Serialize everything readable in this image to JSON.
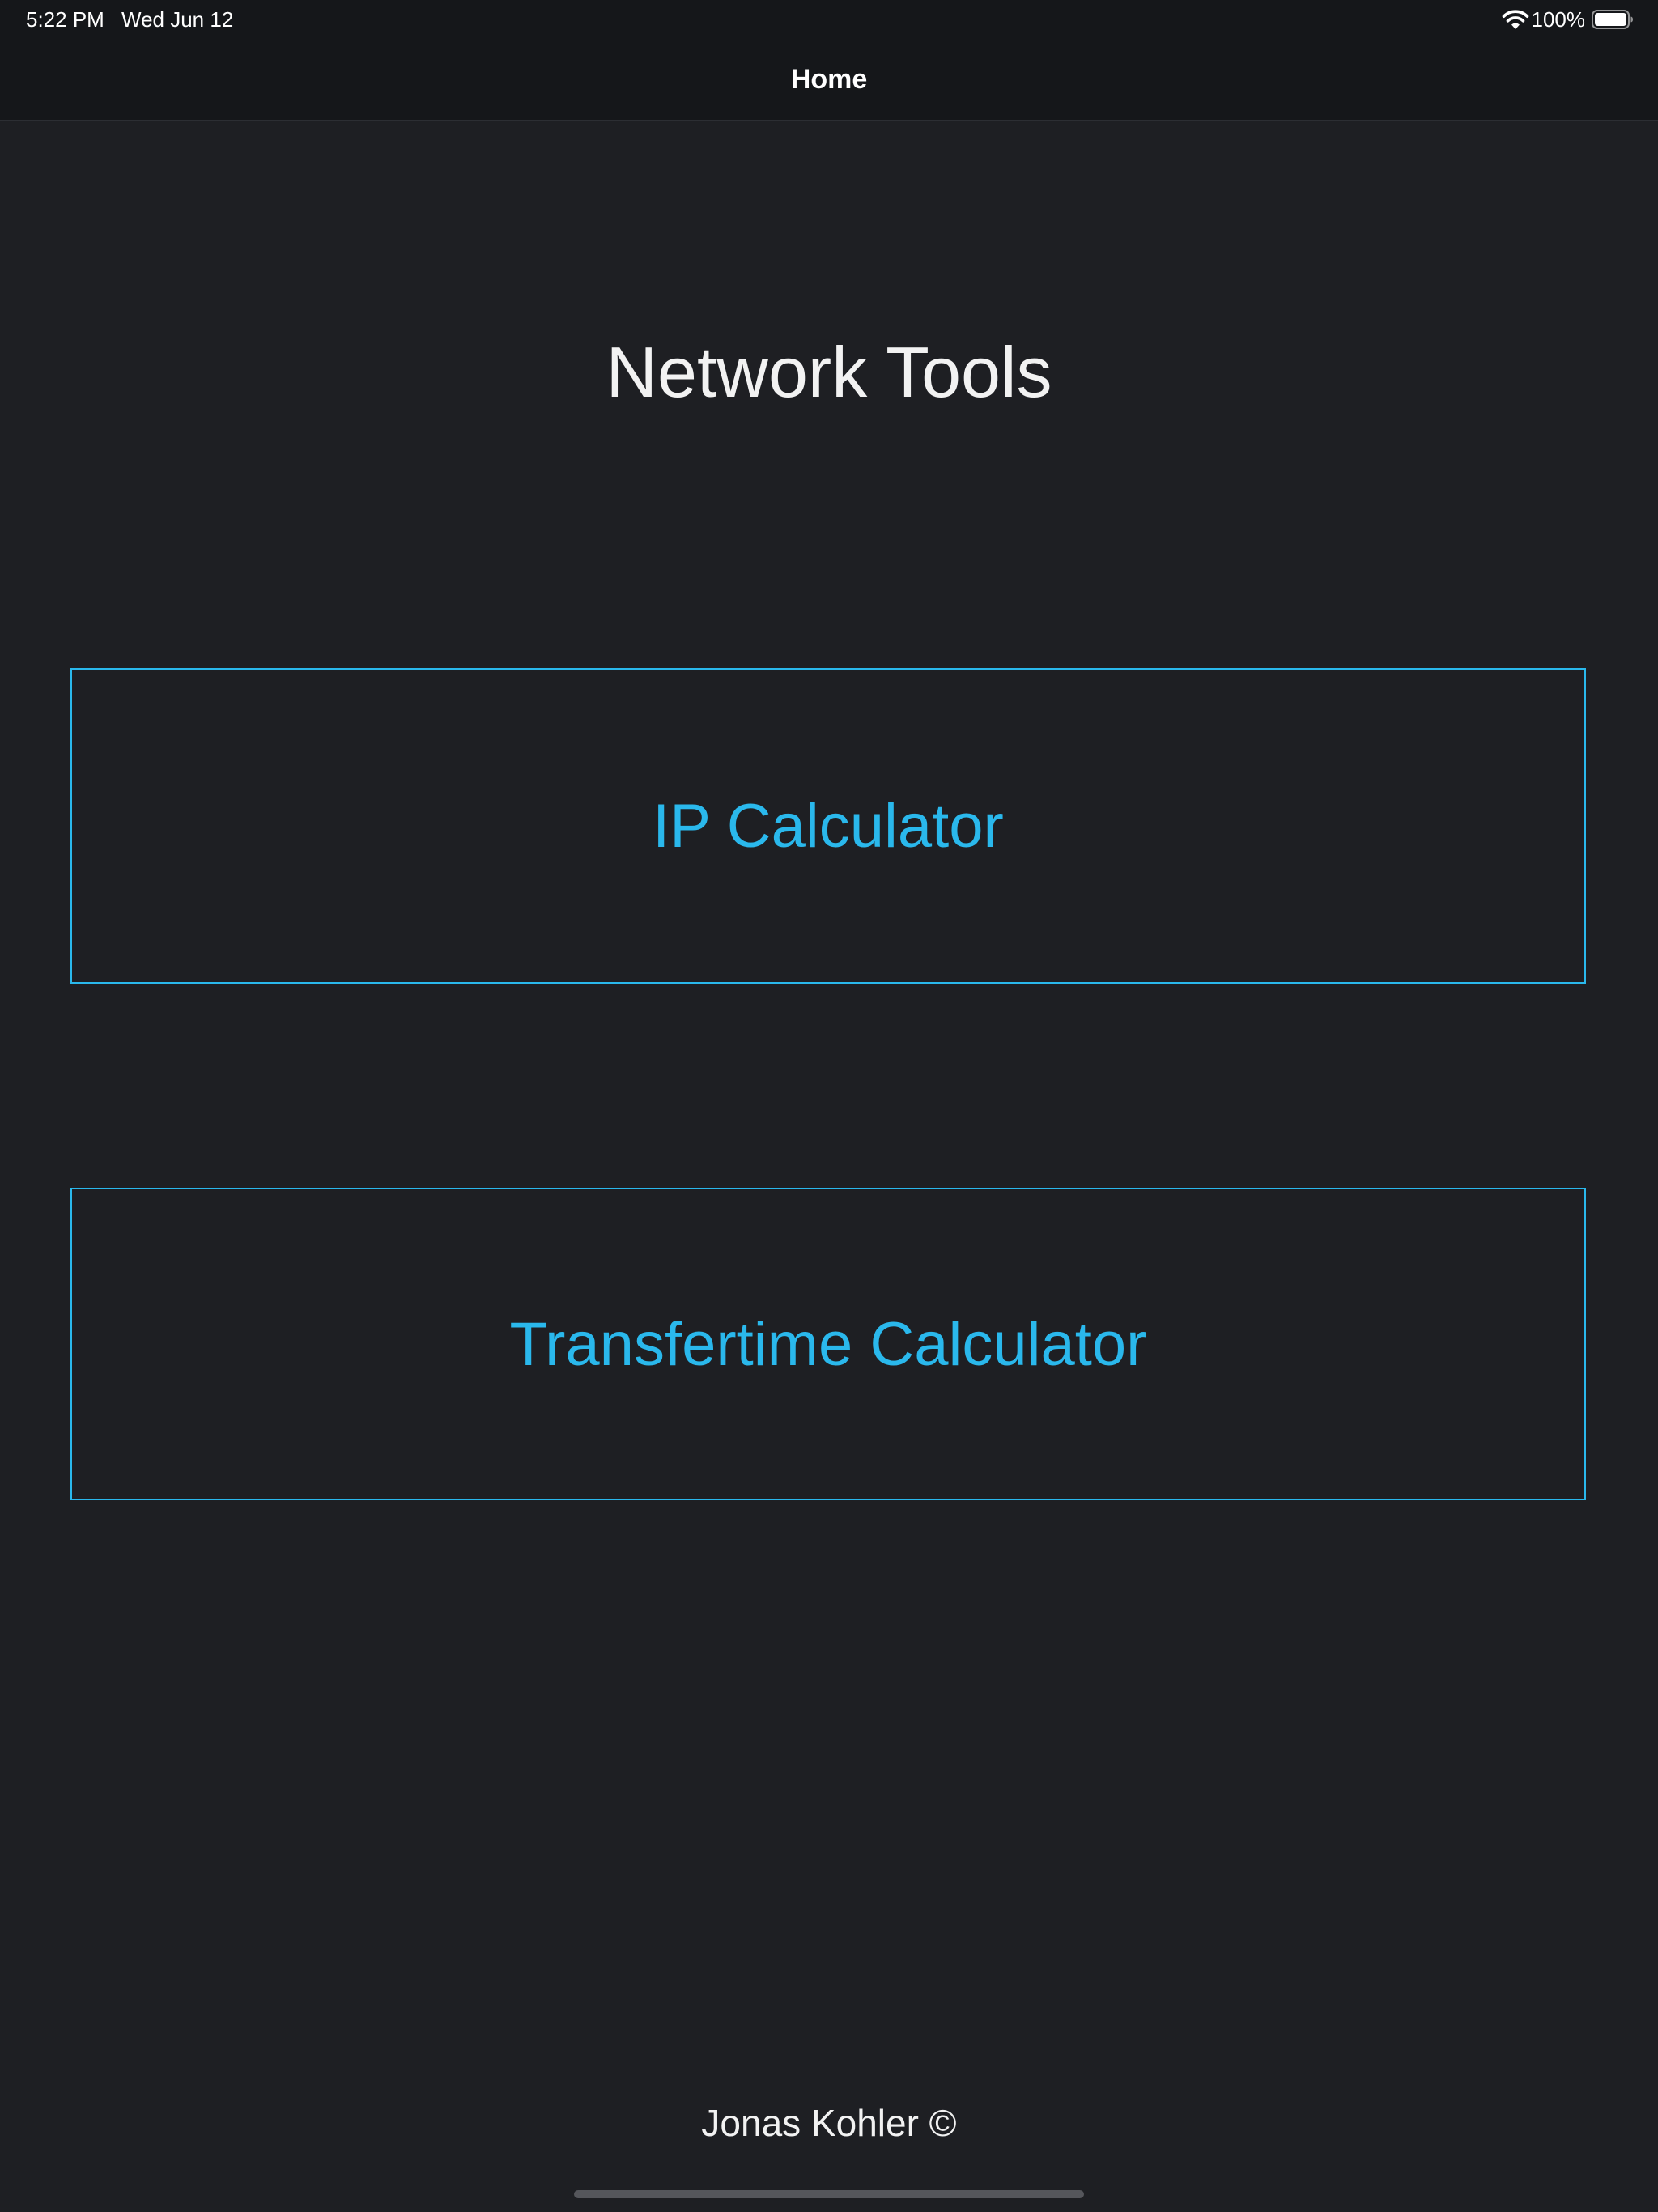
{
  "status_bar": {
    "time": "5:22 PM",
    "date": "Wed Jun 12",
    "battery_percent": "100%",
    "battery_level": 1.0,
    "icons": [
      "wifi-icon",
      "battery-icon"
    ]
  },
  "nav": {
    "title": "Home"
  },
  "main": {
    "title": "Network Tools",
    "buttons": [
      {
        "label": "IP Calculator"
      },
      {
        "label": "Transfertime Calculator"
      }
    ]
  },
  "footer": {
    "text": "Jonas Kohler ©"
  },
  "colors": {
    "background": "#1e1f23",
    "bar_background": "#15171a",
    "accent": "#2ab8ec",
    "text": "#f2f2f2"
  }
}
